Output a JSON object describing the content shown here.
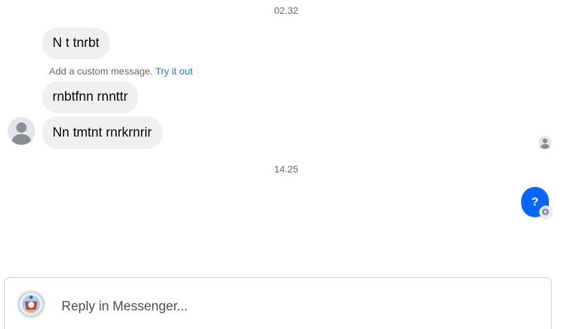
{
  "thread": {
    "timestamps": [
      "02.32",
      "14.25"
    ],
    "incoming": [
      "N t tnrbt",
      "rnbtfnn rnnttr",
      "Nn tmtnt rnrkrnrir"
    ],
    "hint": {
      "text": "Add a custom message.",
      "link": "Try it out"
    },
    "outgoing": [
      "?"
    ]
  },
  "reply": {
    "placeholder": "Reply in Messenger..."
  },
  "icons": {
    "contact_avatar": "person-icon",
    "seen_indicator": "person-icon",
    "read_receipt": "badge-avatar-icon",
    "user_avatar": "badge-avatar-icon"
  },
  "colors": {
    "accent": "#0866ff",
    "link": "#1877f2",
    "bubble_incoming": "#f0f0f0",
    "meta_text": "#65676b"
  }
}
